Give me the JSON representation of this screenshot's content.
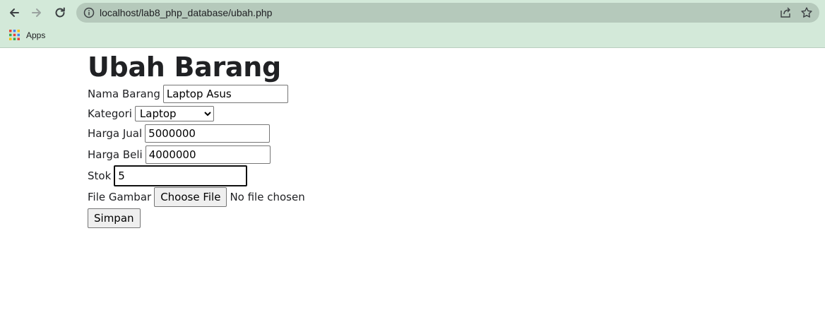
{
  "browser": {
    "url": "localhost/lab8_php_database/ubah.php",
    "bookmarks": {
      "apps_label": "Apps"
    }
  },
  "page": {
    "title": "Ubah Barang",
    "fields": {
      "nama_label": "Nama Barang",
      "nama_value": "Laptop Asus",
      "kategori_label": "Kategori",
      "kategori_value": "Laptop",
      "harga_jual_label": "Harga Jual",
      "harga_jual_value": "5000000",
      "harga_beli_label": "Harga Beli",
      "harga_beli_value": "4000000",
      "stok_label": "Stok",
      "stok_value": "5",
      "file_label": "File Gambar",
      "file_button": "Choose File",
      "file_status": "No file chosen"
    },
    "submit_label": "Simpan"
  },
  "icons": {
    "back": "arrow-left-icon",
    "forward": "arrow-right-icon",
    "reload": "reload-icon",
    "info": "info-icon",
    "share": "share-icon",
    "star": "star-icon",
    "apps": "apps-grid-icon"
  }
}
